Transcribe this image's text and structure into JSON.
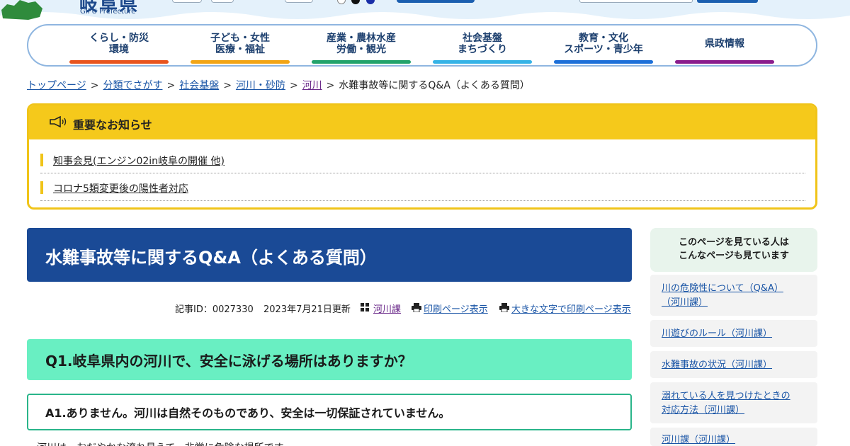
{
  "header": {
    "logo_kanji": "岐阜県",
    "logo_en": "GIFU Prefecture"
  },
  "global_nav": [
    {
      "line1": "くらし・防災",
      "line2": "環境",
      "color": "#e8541e"
    },
    {
      "line1": "子ども・女性",
      "line2": "医療・福祉",
      "color": "#f2a516"
    },
    {
      "line1": "産業・農林水産",
      "line2": "労働・観光",
      "color": "#22a36b"
    },
    {
      "line1": "社会基盤",
      "line2": "まちづくり",
      "color": "#35b3e6"
    },
    {
      "line1": "教育・文化",
      "line2": "スポーツ・青少年",
      "color": "#1c6fd8"
    },
    {
      "line1": "県政情報",
      "line2": "",
      "color": "#8a1c8c"
    }
  ],
  "breadcrumb": {
    "items": [
      "トップページ",
      "分類でさがす",
      "社会基盤",
      "河川・砂防",
      "河川"
    ],
    "current": "水難事故等に関するQ&A（よくある質問）",
    "separator": ">"
  },
  "notice": {
    "title": "重要なお知らせ",
    "icon": "megaphone-icon",
    "items": [
      "知事会見(エンジン02in岐阜の開催 他)",
      "コロナ5類変更後の陽性者対応"
    ]
  },
  "article": {
    "title": "水難事故等に関するQ&A（よくある質問）",
    "record_id": "記事ID：0027330",
    "updated": "2023年7月21日更新",
    "department": "河川課",
    "print_link": "印刷ページ表示",
    "print_large_link": "大きな文字で印刷ページ表示",
    "q1": "Q1.岐阜県内の河川で、安全に泳げる場所はありますか？",
    "a1": "A1.ありません。河川は自然そのものであり、安全は一切保証されていません。",
    "body_partial": "河川は、おだやかな流れ見えて、非常に危険な場所です。"
  },
  "sidebar": {
    "heading_line1": "このページを見ている人は",
    "heading_line2": "こんなページも見ています",
    "links": [
      {
        "line1": "川の危険性について（Q&A）",
        "line2": "（河川課）"
      },
      {
        "line1": "川遊びのルール（河川課）",
        "line2": ""
      },
      {
        "line1": "水難事故の状況（河川課）",
        "line2": ""
      },
      {
        "line1": "溺れている人を見つけたときの",
        "line2": "対応方法（河川課）"
      },
      {
        "line1": "河川課（河川課）",
        "line2": ""
      }
    ]
  },
  "colors": {
    "title_bg": "#1a4a96",
    "notice_yellow": "#f5c91b",
    "q_bg": "#69efc2",
    "a_border": "#2ab58a",
    "link": "#1a55a6"
  }
}
